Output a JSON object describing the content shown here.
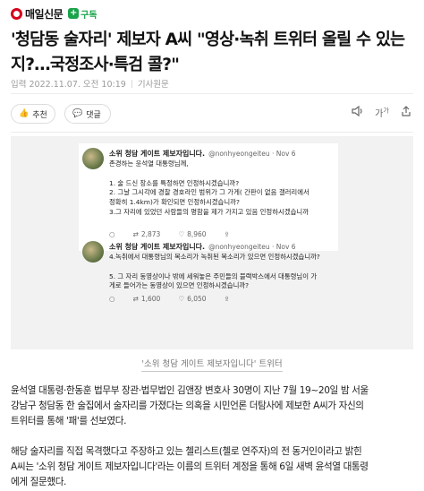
{
  "header": {
    "logo_text": "매일신문",
    "subscribe_label": "구독"
  },
  "article": {
    "title": "'청담동 술자리' 제보자 A씨 \"영상·녹취 트위터 올릴 수 있는지?…국정조사·특검 콜?\"",
    "meta": {
      "date_label": "입력 2022.11.07. 오전 10:19",
      "original_label": "기사원문"
    },
    "actions": {
      "like_label": "추천",
      "comment_label": "댓글"
    }
  },
  "figure": {
    "tweets": [
      {
        "name": "소위 청담 게이트 제보자입니다.",
        "handle": "@nonhyeongeiteu · Nov 6",
        "lines": [
          "존경하는 윤석열 대통령님께,",
          "",
          "1. 술 드신 장소를 특정하면 인정하시겠습니까?",
          "2. 그날 그시각에 경찰 경호라인 범위가 그 가게( 간판이 없음 갤러리에서",
          "정확히 1.4km)가 확인되면 인정하시겠습니까?",
          "3.그 자리에 있었던 사람들의 명함을 제가 가지고 있음 인정하시겠습니까"
        ],
        "retweets": "2,873",
        "likes": "8,960"
      },
      {
        "name": "소위 청담 게이트 제보자입니다.",
        "handle": "@nonhyeongeiteu · Nov 6",
        "lines": [
          "4.녹취에서 대통령님의 목소리가 녹취된 목소리가 있으면 인정하시겠습니까?",
          "",
          "5. 그 자리 동영상이나 밖에 세워놓은 주민들의 블랙박스에서 대통령님이 가",
          "게로 들어가는 동영상이 있으면 인정하시겠습니까?"
        ],
        "retweets": "1,600",
        "likes": "6,050"
      }
    ],
    "caption": "'소위 청담 게이트 제보자입니다' 트위터"
  },
  "body": {
    "paragraph1": [
      "윤석열 대통령·한동훈 법무부 장관·법무법인 김앤장 변호사 30명이 지난 7월 19~20일 밤 서울",
      "강남구 청담동 한 술집에서 술자리를 가졌다는 의혹을 시민언론 더탐사에 제보한 A씨가 자신의",
      "트위터를 통해 '패'를 선보였다."
    ],
    "paragraph2": [
      "해당 술자리를 직접 목격했다고 주장하고 있는 첼리스트(첼로 연주자)의 전 동거인이라고 밝힌",
      "A씨는 '소위 청담 게이트 제보자입니다'라는 이름의 트위터 계정을 통해 6일 새벽 윤석열 대통령",
      "에게 질문했다."
    ]
  }
}
